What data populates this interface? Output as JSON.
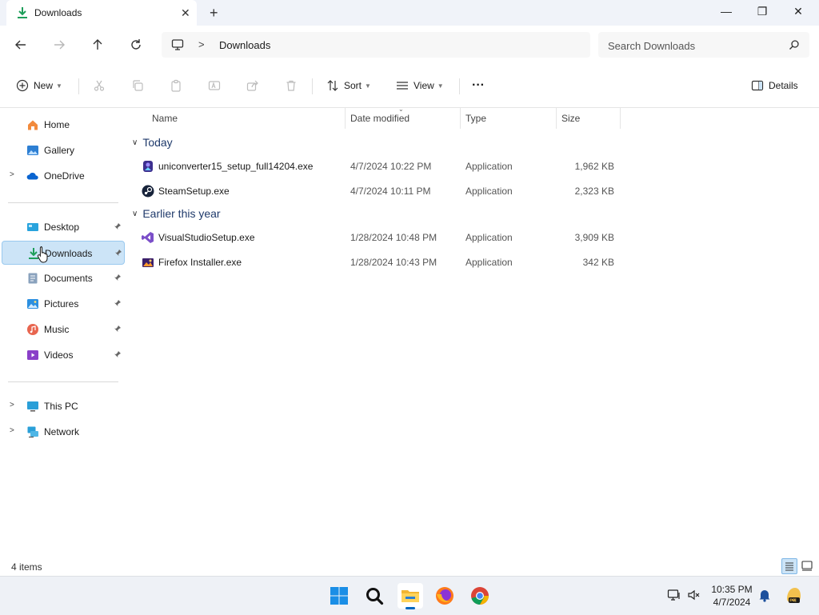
{
  "window": {
    "tab_title": "Downloads",
    "new_tab_label": "+",
    "minimize_label": "—",
    "maximize_label": "❐",
    "close_label": "✕"
  },
  "address": {
    "separator": ">",
    "crumb": "Downloads",
    "search_placeholder": "Search Downloads"
  },
  "toolbar": {
    "new_label": "New",
    "sort_label": "Sort",
    "view_label": "View",
    "more_label": "···",
    "details_label": "Details"
  },
  "sidebar": {
    "items": [
      {
        "label": "Home"
      },
      {
        "label": "Gallery"
      },
      {
        "label": "OneDrive"
      },
      {
        "label": "Desktop"
      },
      {
        "label": "Downloads"
      },
      {
        "label": "Documents"
      },
      {
        "label": "Pictures"
      },
      {
        "label": "Music"
      },
      {
        "label": "Videos"
      },
      {
        "label": "This PC"
      },
      {
        "label": "Network"
      }
    ]
  },
  "columns": {
    "name": "Name",
    "date": "Date modified",
    "type": "Type",
    "size": "Size"
  },
  "groups": [
    {
      "label": "Today",
      "files": [
        {
          "name": "uniconverter15_setup_full14204.exe",
          "date": "4/7/2024 10:22 PM",
          "type": "Application",
          "size": "1,962 KB"
        },
        {
          "name": "SteamSetup.exe",
          "date": "4/7/2024 10:11 PM",
          "type": "Application",
          "size": "2,323 KB"
        }
      ]
    },
    {
      "label": "Earlier this year",
      "files": [
        {
          "name": "VisualStudioSetup.exe",
          "date": "1/28/2024 10:48 PM",
          "type": "Application",
          "size": "3,909 KB"
        },
        {
          "name": "Firefox Installer.exe",
          "date": "1/28/2024 10:43 PM",
          "type": "Application",
          "size": "342 KB"
        }
      ]
    }
  ],
  "status": {
    "item_count": "4 items"
  },
  "taskbar": {
    "time": "10:35 PM",
    "date": "4/7/2024"
  },
  "colors": {
    "accent": "#0067c0",
    "selection_bg": "#cce4f7",
    "group_header": "#1f3a6b",
    "download_green": "#1e9e5a"
  }
}
